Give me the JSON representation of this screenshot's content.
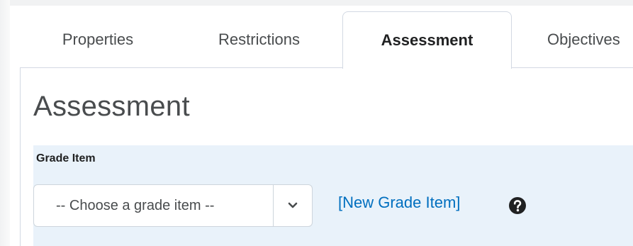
{
  "tabs": {
    "properties": "Properties",
    "restrictions": "Restrictions",
    "assessment": "Assessment",
    "objectives": "Objectives"
  },
  "heading": "Assessment",
  "grade": {
    "label": "Grade Item",
    "select_value": "-- Choose a grade item --",
    "new_link": "[New Grade Item]",
    "help_icon": "question-circle-icon",
    "dropdown_icon": "chevron-down-icon"
  },
  "colors": {
    "link": "#006fbf",
    "section_bg": "#e9f2fa",
    "text": "#494c4e",
    "border": "#d3d9e3"
  }
}
